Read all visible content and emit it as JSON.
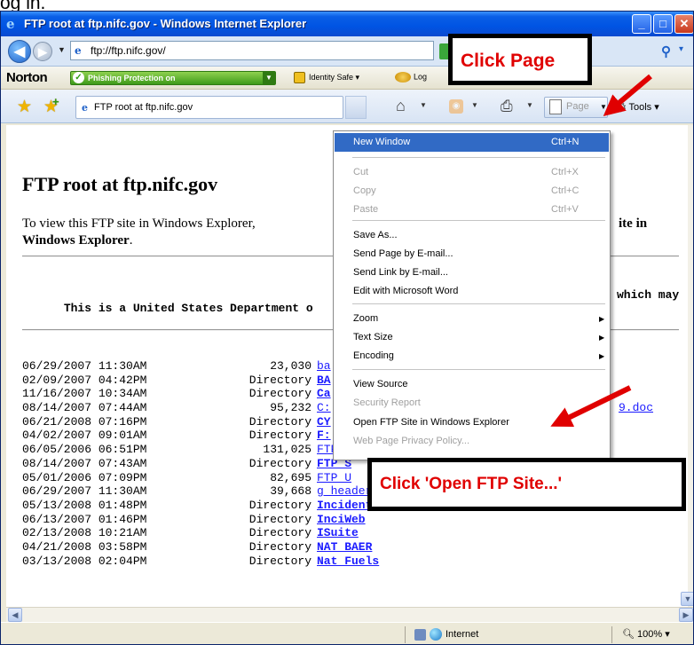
{
  "caption": "og in.",
  "window": {
    "title": "FTP root at ftp.nifc.gov - Windows Internet Explorer",
    "controls": {
      "minimize": "_",
      "maximize": "□",
      "close": "✕"
    }
  },
  "address_bar": {
    "url": "ftp://ftp.nifc.gov/"
  },
  "norton_bar": {
    "logo": "Norton",
    "phishing": "Phishing Protection on",
    "identity_safe": "Identity Safe ▾",
    "log": "Log"
  },
  "command_bar": {
    "tab_label": "FTP root at ftp.nifc.gov",
    "page_label": "Page",
    "tools_label": "Tools ▾"
  },
  "content": {
    "heading": "FTP root at ftp.nifc.gov",
    "instructions_left": "To view this FTP site in Windows Explorer,",
    "instructions_right": "ite in",
    "instructions_second": "Windows Explorer",
    "instructions_period": ".",
    "notice_left": "This is a United States Department o",
    "notice_right": "which may",
    "listing": [
      {
        "date": "06/29/2007 11:30AM",
        "size": "23,030",
        "name": "ba",
        "dir": false
      },
      {
        "date": "02/09/2007 04:42PM",
        "size": "Directory",
        "name": "BA",
        "dir": true
      },
      {
        "date": "11/16/2007 10:34AM",
        "size": "Directory",
        "name": "Ca",
        "dir": true
      },
      {
        "date": "08/14/2007 07:44AM",
        "size": "95,232",
        "name": "C:",
        "dir": false,
        "tail": "9.doc"
      },
      {
        "date": "06/21/2008 07:16PM",
        "size": "Directory",
        "name": "CY",
        "dir": true
      },
      {
        "date": "04/02/2007 09:01AM",
        "size": "Directory",
        "name": "F:",
        "dir": true
      },
      {
        "date": "06/05/2006 06:51PM",
        "size": "131,025",
        "name": "FTP_I",
        "dir": false
      },
      {
        "date": "08/14/2007 07:43AM",
        "size": "Directory",
        "name": "FTP_S",
        "dir": true
      },
      {
        "date": "05/01/2006 07:09PM",
        "size": "82,695",
        "name": "FTP_U",
        "dir": false
      },
      {
        "date": "06/29/2007 11:30AM",
        "size": "39,668",
        "name": "g_header2.jpg",
        "dir": false
      },
      {
        "date": "05/13/2008 01:48PM",
        "size": "Directory",
        "name": "Incident_Specific_Data",
        "dir": true
      },
      {
        "date": "06/13/2007 01:46PM",
        "size": "Directory",
        "name": "InciWeb",
        "dir": true
      },
      {
        "date": "02/13/2008 10:21AM",
        "size": "Directory",
        "name": "ISuite",
        "dir": true
      },
      {
        "date": "04/21/2008 03:58PM",
        "size": "Directory",
        "name": "NAT_BAER",
        "dir": true
      },
      {
        "date": "03/13/2008 02:04PM",
        "size": "Directory",
        "name": "Nat_Fuels",
        "dir": true
      }
    ]
  },
  "menu": {
    "items": [
      {
        "label": "New Window",
        "accel": "Ctrl+N",
        "state": "highlighted"
      },
      {
        "label": "Cut",
        "accel": "Ctrl+X",
        "state": "disabled"
      },
      {
        "label": "Copy",
        "accel": "Ctrl+C",
        "state": "disabled"
      },
      {
        "label": "Paste",
        "accel": "Ctrl+V",
        "state": "disabled"
      },
      {
        "label": "Save As...",
        "accel": "",
        "state": "enabled"
      },
      {
        "label": "Send Page by E-mail...",
        "accel": "",
        "state": "enabled"
      },
      {
        "label": "Send Link by E-mail...",
        "accel": "",
        "state": "enabled"
      },
      {
        "label": "Edit with Microsoft Word",
        "accel": "",
        "state": "enabled"
      },
      {
        "label": "Zoom",
        "accel": "",
        "state": "submenu"
      },
      {
        "label": "Text Size",
        "accel": "",
        "state": "submenu"
      },
      {
        "label": "Encoding",
        "accel": "",
        "state": "submenu"
      },
      {
        "label": "View Source",
        "accel": "",
        "state": "enabled"
      },
      {
        "label": "Security Report",
        "accel": "",
        "state": "disabled"
      },
      {
        "label": "Open FTP Site in Windows Explorer",
        "accel": "",
        "state": "enabled"
      },
      {
        "label": "Web Page Privacy Policy...",
        "accel": "",
        "state": "disabled"
      }
    ]
  },
  "annotations": {
    "click_page": "Click Page",
    "click_open_ftp": "Click 'Open FTP Site...'"
  },
  "status_bar": {
    "zone": "Internet",
    "zoom": "100%"
  },
  "colors": {
    "title_bar": "#0054e3",
    "link": "#1a1aff",
    "menu_highlight": "#316ac5",
    "annotation_red": "#e00000"
  },
  "icons": [
    "ie-icon",
    "back-icon",
    "forward-icon",
    "page-icon",
    "go-icon",
    "search-icon",
    "check-icon",
    "identity-safe-icon",
    "log-icon",
    "favorites-star-icon",
    "add-favorites-icon",
    "home-icon",
    "feeds-icon",
    "print-icon",
    "page-menu-icon",
    "gear-icon",
    "globe-icon",
    "lock-icon"
  ]
}
